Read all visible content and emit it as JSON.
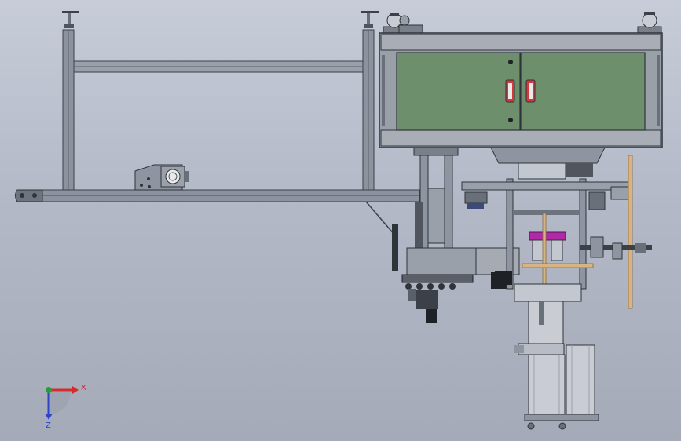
{
  "viewport": {
    "background_top": "#c7ccd8",
    "background_bottom": "#a4aab8"
  },
  "colors": {
    "frame": "#8c929e",
    "frame_dark": "#3c4048",
    "cabinet_door": "#6e8f6c",
    "cabinet_frame": "#9aa0a8",
    "handle": "#d23a3a",
    "magenta_part": "#b02aa8",
    "rod_tan": "#d8b483",
    "cylinder": "#c9ccd2",
    "axis_x": "#d22c2c",
    "axis_y": "#2a9a3a",
    "axis_z": "#2b44c8"
  },
  "triad": {
    "x_label": "X",
    "z_label": "Z"
  }
}
